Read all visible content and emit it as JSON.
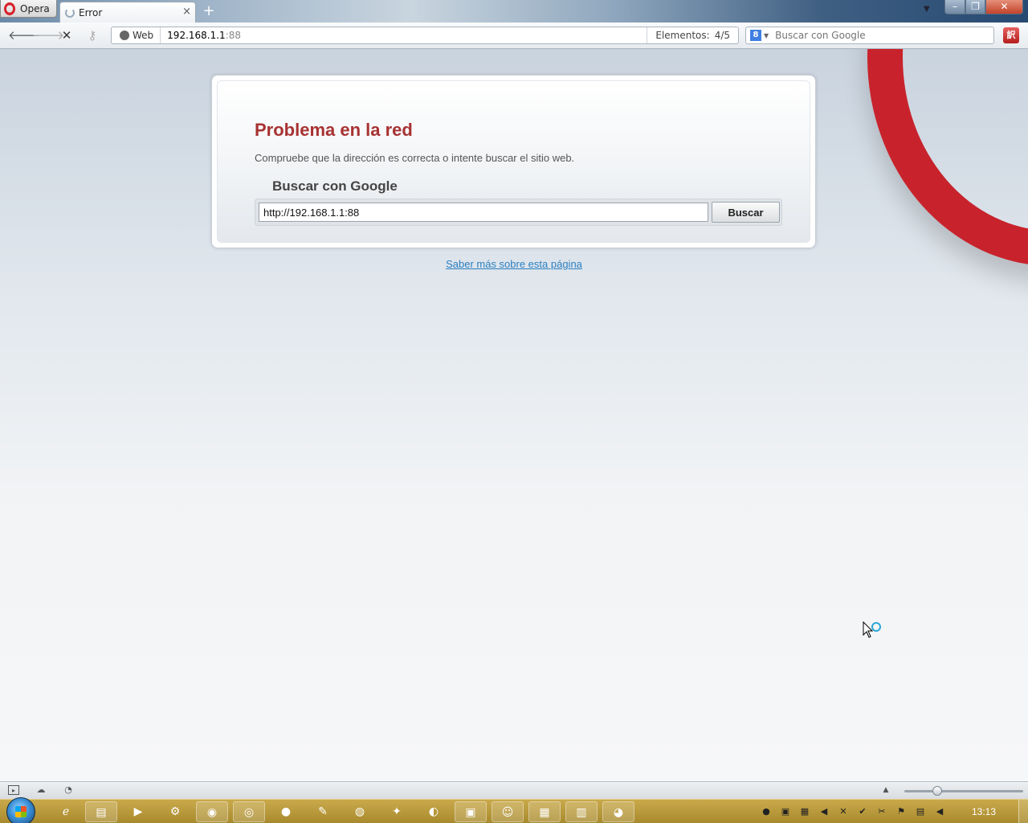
{
  "browser": {
    "menu_label": "Opera",
    "tab": {
      "title": "Error",
      "close": "×"
    },
    "new_tab": "+",
    "address": {
      "mode_label": "Web",
      "url_host": "192.168.1.1",
      "url_port": ":88",
      "elements_label": "Elementos:",
      "elements_value": "4/5"
    },
    "search": {
      "placeholder": "Buscar con Google",
      "engine_icon": "8"
    },
    "window_controls": {
      "minimize": "–",
      "maximize": "❐",
      "close": "✕"
    }
  },
  "error_page": {
    "title": "Problema en la red",
    "description": "Compruebe que la dirección es correcta o intente buscar el sitio web.",
    "search_heading": "Buscar con Google",
    "query_value": "http://192.168.1.1:88",
    "submit_label": "Buscar",
    "learn_more": "Saber más sobre esta página"
  },
  "taskbar": {
    "clock": "13:13"
  },
  "colors": {
    "error_title": "#a83232",
    "link": "#2a7fc0",
    "opera_red": "#c8232c"
  }
}
